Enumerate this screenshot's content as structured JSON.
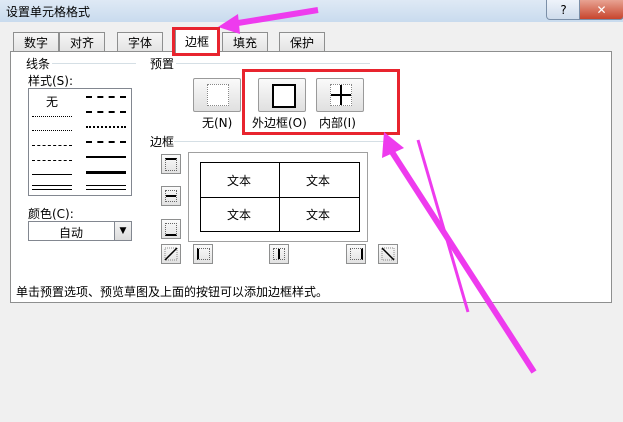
{
  "window": {
    "title": "设置单元格格式",
    "help_glyph": "?",
    "close_glyph": "✕"
  },
  "tabs": [
    {
      "label": "数字"
    },
    {
      "label": "对齐"
    },
    {
      "label": "字体"
    },
    {
      "label": "边框"
    },
    {
      "label": "填充"
    },
    {
      "label": "保护"
    }
  ],
  "active_tab": "边框",
  "line_section": {
    "group_label": "线条",
    "style_label": "样式(S):",
    "none_label": "无",
    "color_label": "颜色(C):",
    "color_value": "自动"
  },
  "presets_section": {
    "group_label": "预置",
    "presets": [
      {
        "label": "无(N)"
      },
      {
        "label": "外边框(O)"
      },
      {
        "label": "内部(I)"
      }
    ]
  },
  "border_section": {
    "group_label": "边框",
    "preview_cells": [
      "文本",
      "文本",
      "文本",
      "文本"
    ]
  },
  "hint_text": "单击预置选项、预览草图及上面的按钮可以添加边框样式。",
  "colors": {
    "highlight_box": "#e8242e",
    "annotation_arrow": "#ee3bee"
  }
}
